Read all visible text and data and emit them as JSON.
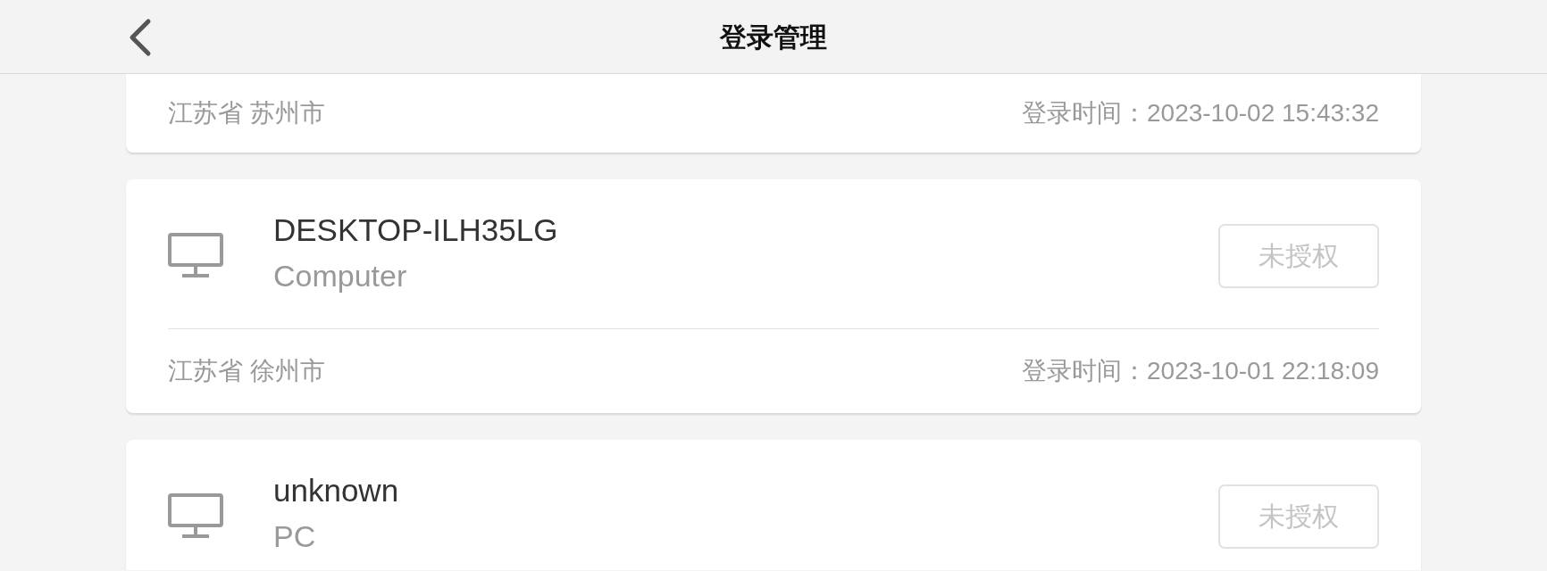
{
  "header": {
    "title": "登录管理"
  },
  "sessions": [
    {
      "location": "江苏省 苏州市",
      "login_time": "登录时间：2023-10-02 15:43:32"
    },
    {
      "name": "DESKTOP-ILH35LG",
      "type": "Computer",
      "button": "未授权",
      "location": "江苏省 徐州市",
      "login_time": "登录时间：2023-10-01 22:18:09"
    },
    {
      "name": "unknown",
      "type": "PC",
      "button": "未授权"
    }
  ]
}
